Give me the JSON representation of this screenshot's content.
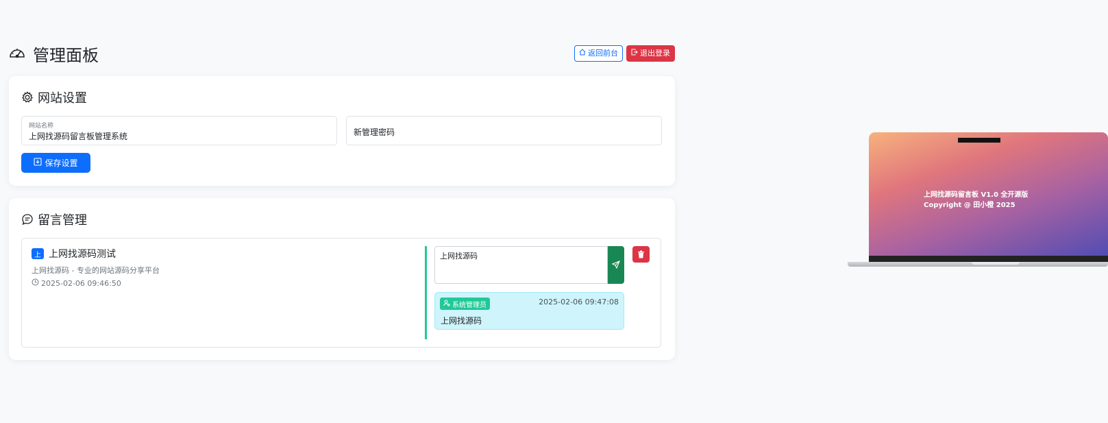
{
  "header": {
    "title": "管理面板",
    "back_label": "返回前台",
    "logout_label": "退出登录"
  },
  "settings": {
    "title": "网站设置",
    "site_name_label": "网站名称",
    "site_name_value": "上网找源码留言板管理系统",
    "password_placeholder": "新管理密码",
    "save_label": "保存设置"
  },
  "messages": {
    "title": "留言管理",
    "items": [
      {
        "avatar": "上",
        "title": "上网找源码测试",
        "content": "上网找源码 - 专业的网站源码分享平台",
        "time": "2025-02-06 09:46:50",
        "reply_draft": "上网找源码",
        "reply": {
          "author": "系统管理员",
          "time": "2025-02-06 09:47:08",
          "text": "上网找源码"
        }
      }
    ]
  },
  "preview": {
    "line1": "上网找源码留言板 V1.0 全开源版",
    "line2": "Copyright @ 田小橙 2025"
  },
  "colors": {
    "primary": "#0d6efd",
    "danger": "#dc3545",
    "success": "#198754",
    "teal": "#20c997",
    "info_bg": "#cff4fc"
  }
}
